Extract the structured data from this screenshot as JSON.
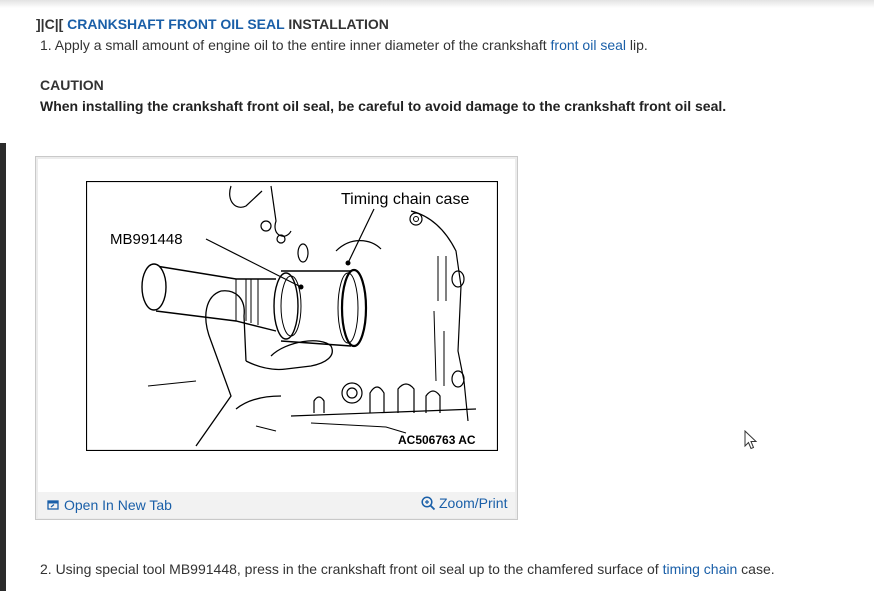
{
  "section": {
    "prefix": "]|C|[",
    "title_link": "CRANKSHAFT FRONT OIL SEAL",
    "title_suffix": "INSTALLATION"
  },
  "step1": {
    "text": "1. Apply a small amount of engine oil to the entire inner diameter of the crankshaft ",
    "link": "front oil seal",
    "suffix": " lip."
  },
  "caution": {
    "title": "CAUTION",
    "text": "When installing the crankshaft front oil seal, be careful to avoid damage to the crankshaft front oil seal."
  },
  "figure": {
    "label_tool": "MB991448",
    "label_case": "Timing chain case",
    "figure_code": "AC506763 AC",
    "open_tab": "Open In New Tab",
    "zoom_print": "Zoom/Print"
  },
  "step2": {
    "text": "2. Using special tool MB991448, press in the crankshaft front oil seal up to the chamfered surface of ",
    "link": "timing chain",
    "suffix": " case."
  },
  "colors": {
    "link": "#1a5fa8",
    "text": "#333333"
  }
}
